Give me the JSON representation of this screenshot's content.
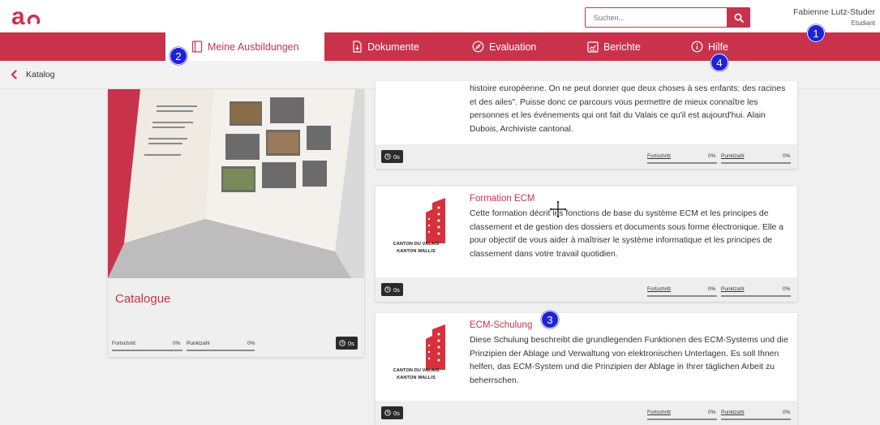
{
  "header": {
    "search_placeholder": "Suchen...",
    "user_name": "Fabienne Lutz-Studer",
    "user_role": "Etudiant"
  },
  "nav": {
    "items": [
      {
        "label": "Meine Ausbildungen",
        "icon": "book-icon",
        "active": true
      },
      {
        "label": "Dokumente",
        "icon": "document-icon",
        "active": false
      },
      {
        "label": "Evaluation",
        "icon": "compass-icon",
        "active": false
      },
      {
        "label": "Berichte",
        "icon": "report-icon",
        "active": false
      },
      {
        "label": "Hilfe",
        "icon": "info-icon",
        "active": false
      }
    ]
  },
  "breadcrumb": {
    "label": "Katalog"
  },
  "catalogue": {
    "title": "Catalogue",
    "progress_label": "Fortschritt",
    "progress_value": "0%",
    "score_label": "Punktzahl",
    "score_value": "0%",
    "time": "0s"
  },
  "courses": [
    {
      "title": "",
      "description": "histoire européenne. On ne peut donner que deux choses à ses enfants: des racines et des ailes\". Puisse donc ce parcours vous permettre de mieux connaître les personnes et les événements qui ont fait du Valais ce qu'il est aujourd'hui. Alain Dubois, Archiviste cantonal.",
      "time": "0s",
      "progress_label": "Fortschritt",
      "progress_value": "0%",
      "score_label": "Punktzahl",
      "score_value": "0%"
    },
    {
      "title": "Formation ECM",
      "description": "Cette formation décrit les fonctions de base du système ECM et les principes de classement et de gestion des dossiers et documents sous forme électronique. Elle a pour objectif de vous aider à maîtriser le système informatique et les principes de classement dans votre travail quotidien.",
      "logo_line1": "CANTON DU VALAIS",
      "logo_line2": "KANTON WALLIS",
      "time": "0s",
      "progress_label": "Fortschritt",
      "progress_value": "0%",
      "score_label": "Punktzahl",
      "score_value": "0%"
    },
    {
      "title": "ECM-Schulung",
      "description": "Diese Schulung beschreibt die grundlegenden Funktionen des ECM-Systems und die Prinzipien der Ablage und Verwaltung von elektronischen Unterlagen. Es soll Ihnen helfen, das ECM-System und die Prinzipien der Ablage in Ihrer täglichen Arbeit zu beherrschen.",
      "logo_line1": "CANTON DU VALAIS",
      "logo_line2": "KANTON WALLIS",
      "time": "0s",
      "progress_label": "Fortschritt",
      "progress_value": "0%",
      "score_label": "Punktzahl",
      "score_value": "0%"
    }
  ],
  "markers": [
    "1",
    "2",
    "3",
    "4"
  ],
  "colors": {
    "accent": "#c8334b",
    "marker": "#1f22d6"
  }
}
